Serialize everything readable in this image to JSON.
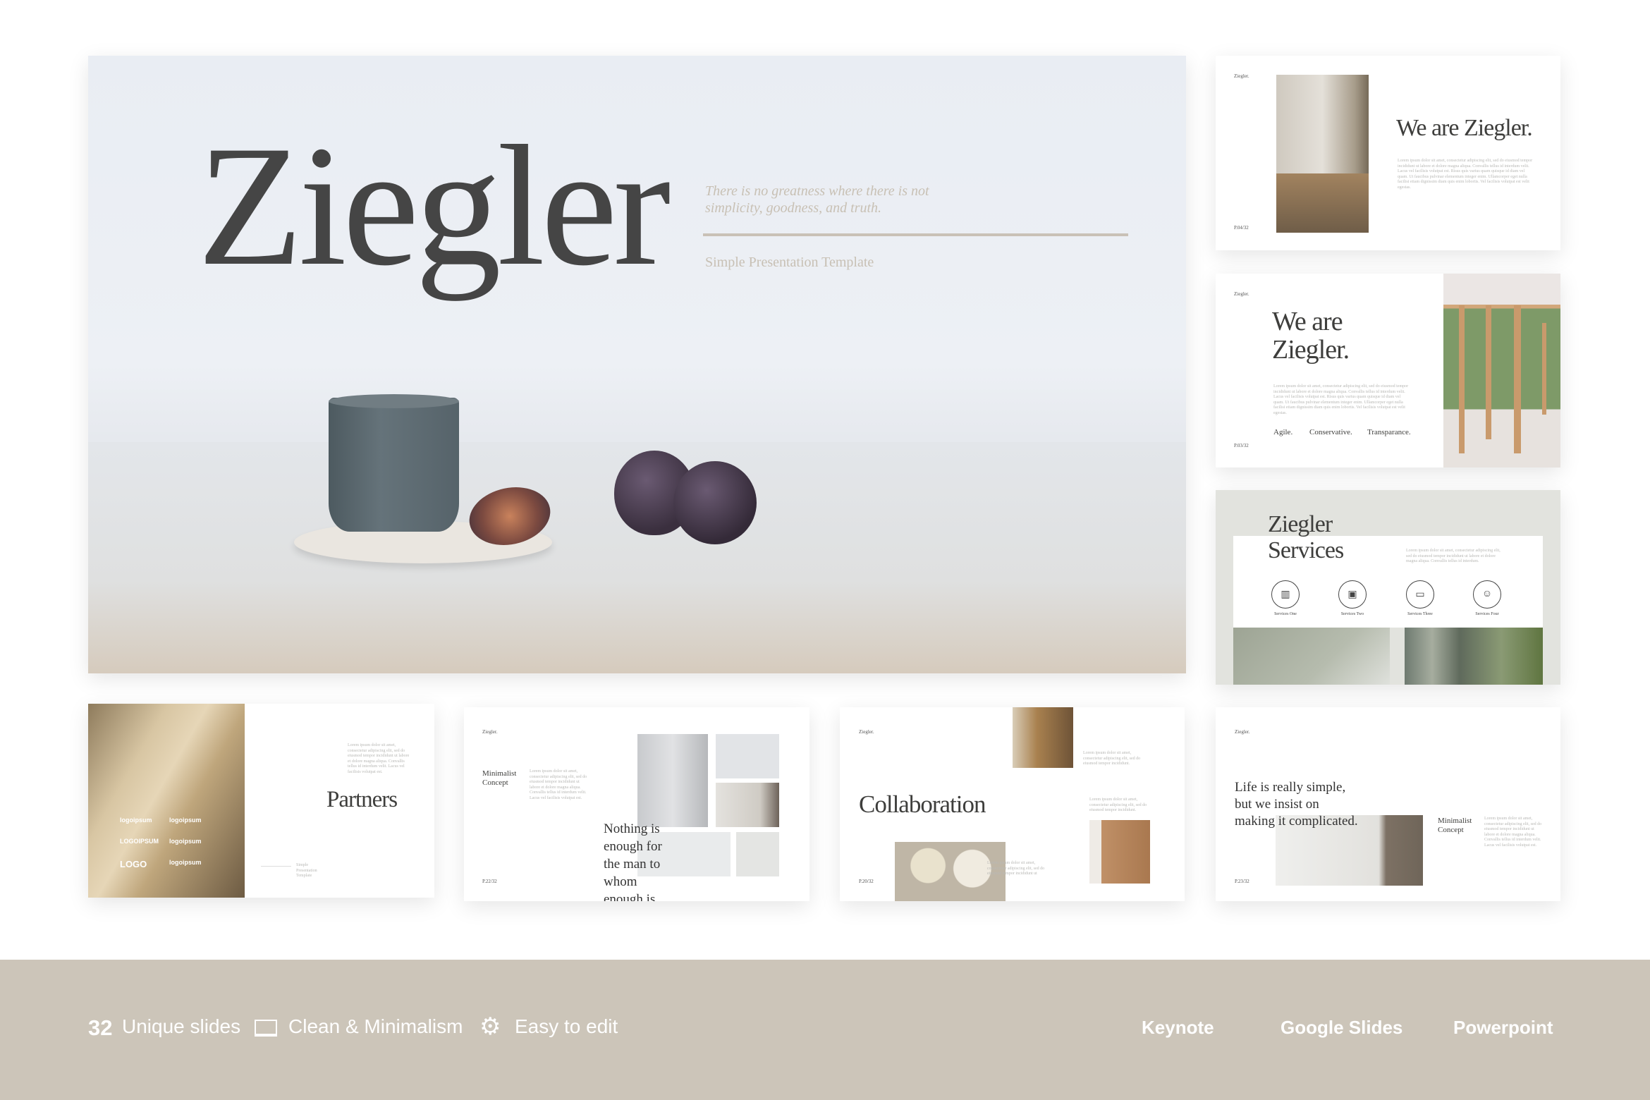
{
  "main_slide": {
    "title": "Ziegler",
    "quote": "There is no greatness where there is not simplicity, goodness, and truth.",
    "subtitle": "Simple Presentation Template"
  },
  "slides": {
    "we_are": {
      "brand": "Ziegler.",
      "title": "We are Ziegler.",
      "body": "Lorem ipsum dolor sit amet, consectetur adipiscing elit, sed do eiusmod tempor incididunt ut labore et dolore magna aliqua. Convallis tellus id interdum velit. Lacus vel facilisis volutpat est. Risus quis varius quam quisque id diam vel quam. Ut faucibus pulvinar elementum integer enim. Ullamcorper eget nulla facilisi etiam dignissim diam quis enim lobortis. Vel facilisis volutpat est velit egestas.",
      "page": "P.04/32"
    },
    "we_are_2": {
      "brand": "Ziegler.",
      "title_line1": "We are",
      "title_line2": "Ziegler.",
      "body": "Lorem ipsum dolor sit amet, consectetur adipiscing elit, sed do eiusmod tempor incididunt ut labore et dolore magna aliqua. Convallis tellus id interdum velit. Lacus vel facilisis volutpat est. Risus quis varius quam quisque id diam vel quam. Ut faucibus pulvinar elementum integer enim. Ullamcorper eget nulla facilisi etiam dignissim diam quis enim lobortis. Vel facilisis volutpat est velit egestas.",
      "values": [
        "Agile.",
        "Conservative.",
        "Transparance."
      ],
      "page": "P.03/32"
    },
    "services": {
      "title_line1": "Ziegler",
      "title_line2": "Services",
      "body": "Lorem ipsum dolor sit amet, consectetur adipiscing elit, sed do eiusmod tempor incididunt ut labore et dolore magna aliqua. Convallis tellus id interdum.",
      "items": [
        {
          "label": "Services One",
          "icon": "bar-chart-icon"
        },
        {
          "label": "Services Two",
          "icon": "video-camera-icon"
        },
        {
          "label": "Services Three",
          "icon": "devices-icon"
        },
        {
          "label": "Services Four",
          "icon": "smiley-icon"
        }
      ]
    },
    "partners": {
      "title": "Partners",
      "body": "Lorem ipsum dolor sit amet, consectetur adipiscing elit, sed do eiusmod tempor incididunt ut labore et dolore magna aliqua. Convallis tellus id interdum velit. Lacus vel facilisis volutpat est.",
      "footer": "Simple Presentation Template",
      "logos": [
        "logoipsum",
        "logoipsum",
        "LOGOIPSUM",
        "logoipsum",
        "LOGO",
        "logoipsum"
      ]
    },
    "minimalist": {
      "brand": "Ziegler.",
      "heading_line1": "Minimalist",
      "heading_line2": "Concept",
      "body": "Lorem ipsum dolor sit amet, consectetur adipiscing elit, sed do eiusmod tempor incididunt ut labore et dolore magna aliqua. Convallis tellus id interdum velit. Lacus vel facilisis volutpat est.",
      "quote": "Nothing is enough for the man to whom enough is too little",
      "page": "P.22/32"
    },
    "collaboration": {
      "brand": "Ziegler.",
      "title": "Collaboration",
      "body1": "Lorem ipsum dolor sit amet, consectetur adipiscing elit, sed do eiusmod tempor incididunt.",
      "body2": "Lorem ipsum dolor sit amet, consectetur adipiscing elit, sed do eiusmod tempor incididunt.",
      "body3": "Lorem ipsum dolor sit amet, consectetur adipiscing elit, sed do eiusmod tempor incididunt ut",
      "page": "P.20/32"
    },
    "life": {
      "brand": "Ziegler.",
      "quote_line1": "Life is really simple,",
      "quote_line2": "but we insist on",
      "quote_line3": "making it complicated.",
      "heading_line1": "Minimalist",
      "heading_line2": "Concept",
      "body": "Lorem ipsum dolor sit amet, consectetur adipiscing elit, sed do eiusmod tempor incididunt ut labore et dolore magna aliqua. Convallis tellus id interdum velit. Lacus vel facilisis volutpat est.",
      "page": "P.23/32"
    }
  },
  "footer": {
    "count": "32",
    "count_label": "Unique slides",
    "feature2": "Clean & Minimalism",
    "feature2_icon": "monitor-icon",
    "feature3": "Easy to edit",
    "feature3_icon": "gear-icon",
    "formats": [
      "Keynote",
      "Google Slides",
      "Powerpoint"
    ],
    "background_color": "#ccc5b9"
  }
}
